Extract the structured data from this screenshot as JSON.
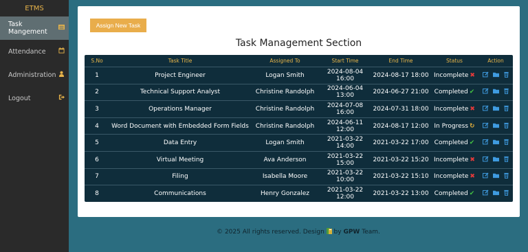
{
  "sidebar": {
    "brand": "ETMS",
    "items": [
      {
        "label": "Task Mangement",
        "icon": "list-icon"
      },
      {
        "label": "Attendance",
        "icon": "calendar-icon"
      },
      {
        "label": "Administration",
        "icon": "user-icon"
      },
      {
        "label": "Logout",
        "icon": "logout-icon"
      }
    ]
  },
  "main": {
    "assign_button": "Assign New Task",
    "section_title": "Task Management Section",
    "table": {
      "headers": [
        "S.No",
        "Task Title",
        "Assigned To",
        "Start Time",
        "End Time",
        "Status",
        "Action"
      ],
      "rows": [
        {
          "sno": "1",
          "title": "Project Engineer",
          "assigned": "Logan Smith",
          "start": "2024-08-04 16:00",
          "end": "2024-08-17 18:00",
          "status": "Incomplete",
          "status_icon": "cross-icon"
        },
        {
          "sno": "2",
          "title": "Technical Support Analyst",
          "assigned": "Christine Randolph",
          "start": "2024-06-04 13:00",
          "end": "2024-06-27 21:00",
          "status": "Completed",
          "status_icon": "check-icon"
        },
        {
          "sno": "3",
          "title": "Operations Manager",
          "assigned": "Christine Randolph",
          "start": "2024-07-08 16:00",
          "end": "2024-07-31 18:00",
          "status": "Incomplete",
          "status_icon": "cross-icon"
        },
        {
          "sno": "4",
          "title": "Word Document with Embedded Form Fields",
          "assigned": "Christine Randolph",
          "start": "2024-06-11 12:00",
          "end": "2024-08-17 12:00",
          "status": "In Progress",
          "status_icon": "sync-icon"
        },
        {
          "sno": "5",
          "title": "Data Entry",
          "assigned": "Logan Smith",
          "start": "2021-03-22 14:00",
          "end": "2021-03-22 17:00",
          "status": "Completed",
          "status_icon": "check-icon"
        },
        {
          "sno": "6",
          "title": "Virtual Meeting",
          "assigned": "Ava Anderson",
          "start": "2021-03-22 15:00",
          "end": "2021-03-22 15:20",
          "status": "Incomplete",
          "status_icon": "cross-icon"
        },
        {
          "sno": "7",
          "title": "Filing",
          "assigned": "Isabella Moore",
          "start": "2021-03-22 10:00",
          "end": "2021-03-22 15:10",
          "status": "Incomplete",
          "status_icon": "cross-icon"
        },
        {
          "sno": "8",
          "title": "Communications",
          "assigned": "Henry Gonzalez",
          "start": "2021-03-22 12:00",
          "end": "2021-03-22 13:00",
          "status": "Completed",
          "status_icon": "check-icon"
        }
      ]
    }
  },
  "footer": {
    "prefix": "© 2025 All rights reserved. Design",
    "by": "by",
    "team_name": "GPW",
    "suffix": "Team."
  },
  "colors": {
    "sidebar_bg": "#2a2a2a",
    "active_item_bg": "#5f6e72",
    "brand": "#e8b44a",
    "page_bg": "#2b6d80",
    "table_bg": "#0f2d3b",
    "header_text": "#e9b64a",
    "button_bg": "#e9ad4b",
    "action_icon": "#3f9be0",
    "status_incomplete": "#e23a3a",
    "status_completed": "#43c143",
    "status_in_progress": "#e8b23c"
  }
}
